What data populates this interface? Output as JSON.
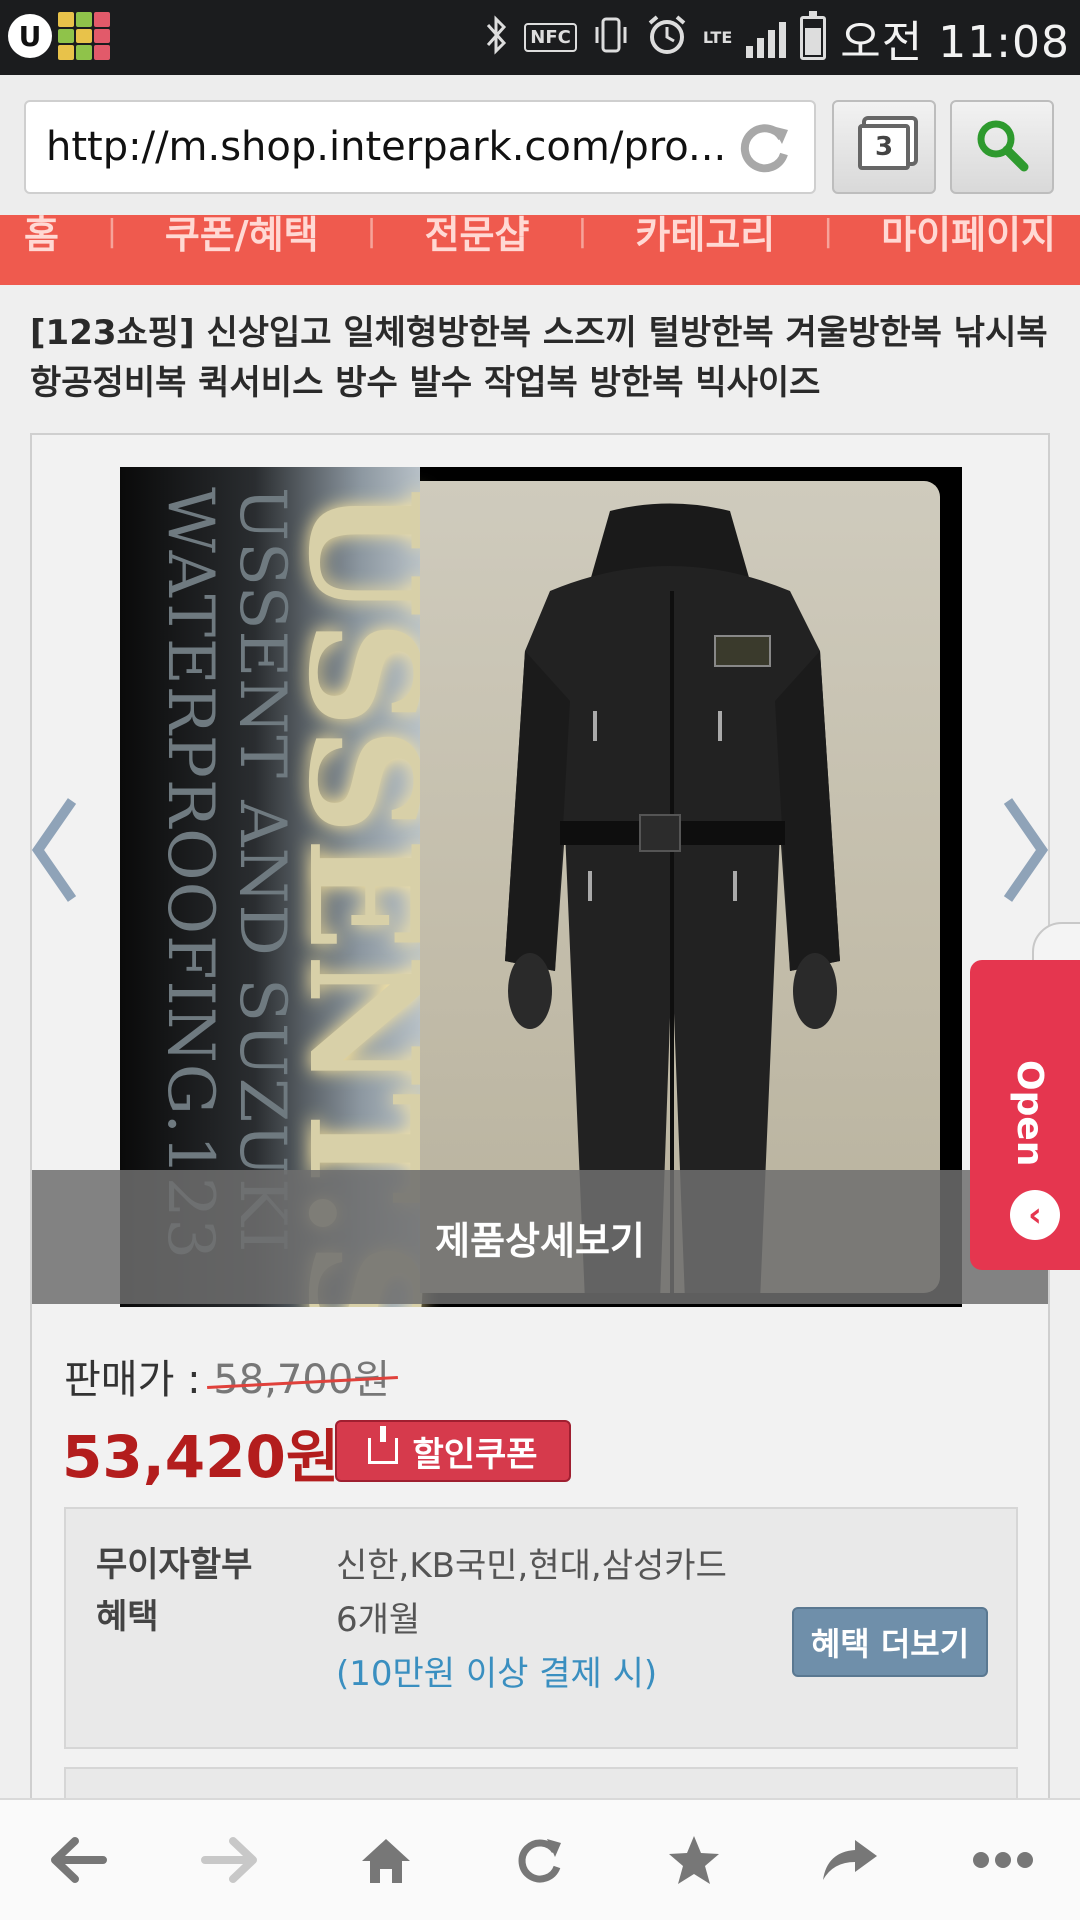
{
  "status_bar": {
    "app_badge": "U",
    "nfc": "NFC",
    "network": "LTE",
    "time": "오전 11:08"
  },
  "browser": {
    "url": "http://m.shop.interpark.com/pro...",
    "tab_count": "3"
  },
  "nav": {
    "items": [
      "홈",
      "쿠폰/혜택",
      "전문샵",
      "카테고리",
      "마이페이지"
    ]
  },
  "product": {
    "title": "[123쇼핑] 신상입고 일체형방한복 스즈끼 털방한복 겨울방한복 낚시복 항공정비복 퀵서비스 방수 발수 작업복 방한복 빅사이즈",
    "image_text": {
      "line1": "USSENT.SZ",
      "line2": "USSENT AND SUZUKI",
      "line3": "WATERPROOFING.123"
    },
    "detail_label": "제품상세보기",
    "price_label": "판매가 : ",
    "original_price": "58,700원",
    "sale_price": "53,420원",
    "coupon_label": "할인쿠폰"
  },
  "benefit": {
    "title": "무이자할부 혜택",
    "cards": "신한,KB국민,현대,삼성카드",
    "months": "6개월",
    "note": "(10만원 이상 결제 시)",
    "more_label": "혜택 더보기"
  },
  "side_tab": {
    "label": "Open"
  },
  "colors": {
    "nav_red": "#ef5a4e",
    "price_red": "#b31d1d",
    "coupon_red": "#d63a4c",
    "benefit_blue": "#3a8fc0",
    "more_button": "#6f8faa",
    "search_green": "#2e9a2e"
  },
  "icons": [
    "bluetooth-icon",
    "vibrate-icon",
    "alarm-icon",
    "signal-icon",
    "battery-icon",
    "reload-icon",
    "tabs-icon",
    "search-icon",
    "back-icon",
    "forward-icon",
    "home-icon",
    "refresh-icon",
    "bookmark-icon",
    "share-icon",
    "more-icon"
  ]
}
